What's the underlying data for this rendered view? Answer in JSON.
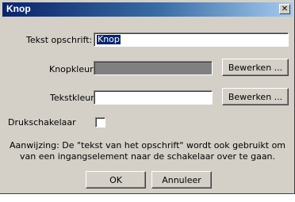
{
  "window": {
    "title": "Knop",
    "close_glyph": "✕"
  },
  "form": {
    "caption_label": "Tekst opschrift:",
    "caption_value": "Knop",
    "button_color_label": "Knopkleur:",
    "text_color_label": "Tekstkleur:",
    "toggle_label": "Drukschakelaar",
    "edit_button_label": "Bewerken ...",
    "button_color": "#808080",
    "text_color": "#ffffff"
  },
  "hint": "Aanwijzing: De \"tekst van het opschrift\" wordt ook gebruikt om van een ingangselement naar de schakelaar over te gaan.",
  "actions": {
    "ok_label": "OK",
    "cancel_label": "Annuleer"
  }
}
